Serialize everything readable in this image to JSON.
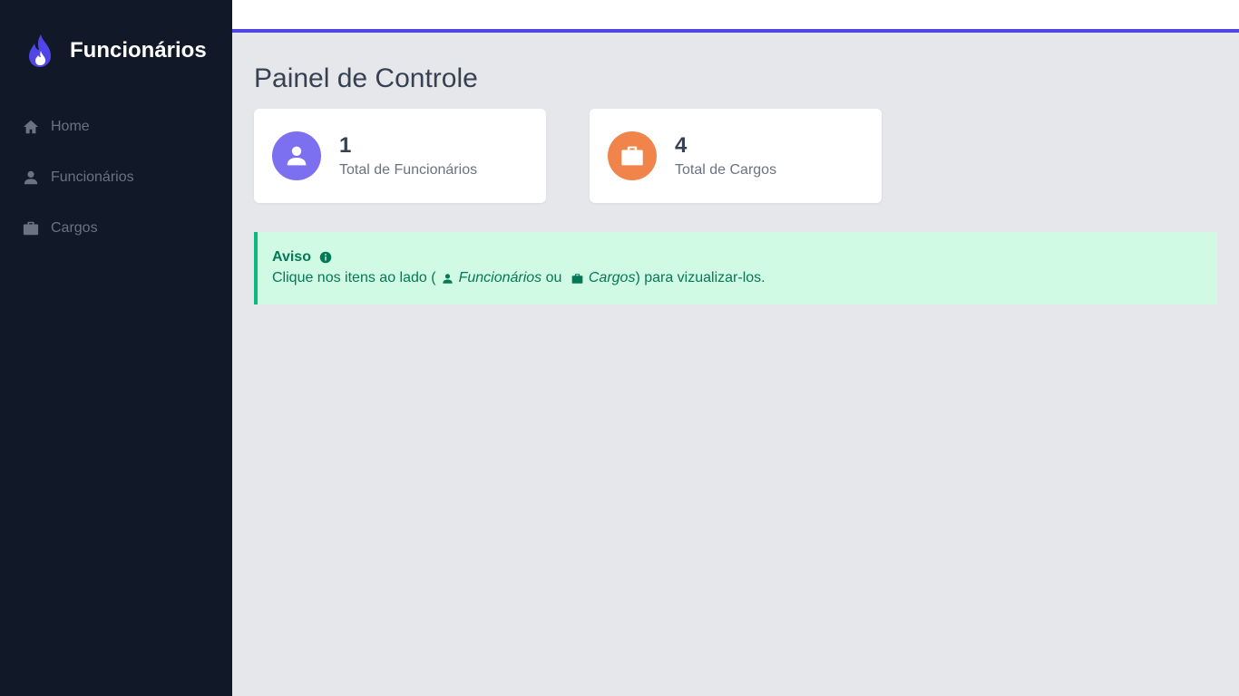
{
  "sidebar": {
    "brand": {
      "title": "Funcionários",
      "logo_icon": "flame-icon",
      "logo_color": "#4f46e5"
    },
    "items": [
      {
        "label": "Home",
        "icon": "home-icon"
      },
      {
        "label": "Funcionários",
        "icon": "user-icon"
      },
      {
        "label": "Cargos",
        "icon": "briefcase-icon"
      }
    ]
  },
  "topbar": {
    "accent_color": "#4f46e5"
  },
  "main": {
    "title": "Painel de Controle",
    "cards": [
      {
        "value": "1",
        "label": "Total de Funcionários",
        "icon": "user-icon",
        "color": "#7c6ff0"
      },
      {
        "value": "4",
        "label": "Total de Cargos",
        "icon": "briefcase-icon",
        "color": "#f0844a"
      }
    ],
    "alert": {
      "title": "Aviso",
      "icon": "info-icon",
      "text_before": "Clique nos itens ao lado (",
      "link1": "Funcionários",
      "middle": " ou ",
      "link2": "Cargos",
      "text_after": ") para vizualizar-los.",
      "color": "#047857",
      "background": "#d1fae5"
    }
  }
}
